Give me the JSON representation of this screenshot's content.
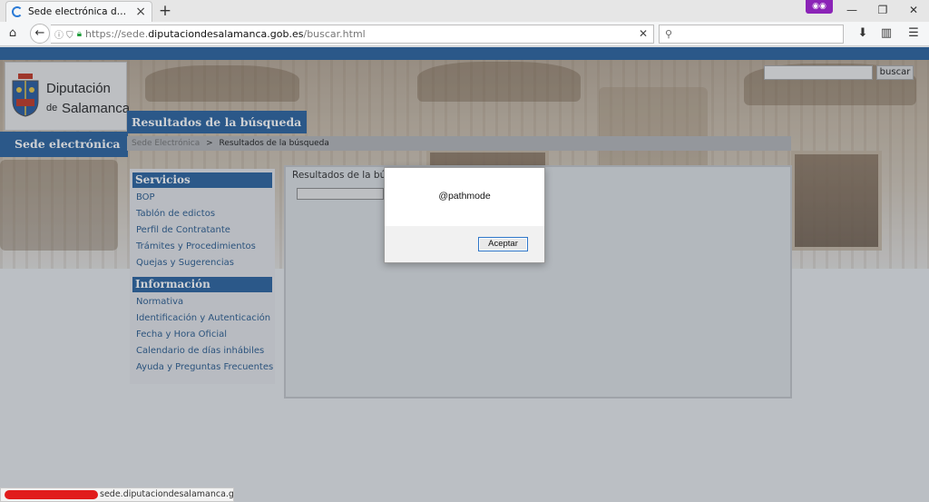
{
  "browser": {
    "tab_title": "Sede electrónica de la Dip...",
    "url_scheme": "https://sede.",
    "url_host": "diputaciondesalamanca.gob.es",
    "url_path": "/buscar.html",
    "icons": {
      "tab_loading": "loading-spinner-icon",
      "home": "home-icon",
      "back": "arrow-left-icon",
      "search": "magnifier-icon",
      "downloads": "download-arrow-icon",
      "sidebar": "sidebar-icon",
      "menu": "hamburger-menu-icon",
      "private": "private-browsing-mask-icon"
    }
  },
  "site": {
    "logo_line1": "Diputación",
    "logo_line2_prefix": "de",
    "logo_line2": "Salamanca",
    "sede_label": "Sede electrónica",
    "results_heading": "Resultados de la búsqueda",
    "search_button": "buscar",
    "breadcrumb": {
      "home": "Sede Electrónica",
      "separator": ">",
      "current": "Resultados de la búsqueda"
    },
    "accent_color": "#2f66a0"
  },
  "sidebar": {
    "servicios_title": "Servicios",
    "servicios": [
      "BOP",
      "Tablón de edictos",
      "Perfil de Contratante",
      "Trámites y Procedimientos",
      "Quejas y Sugerencias"
    ],
    "informacion_title": "Información",
    "informacion": [
      "Normativa",
      "Identificación y Autenticación",
      "Fecha y Hora Oficial",
      "Calendario de días inhábiles",
      "Ayuda y Preguntas Frecuentes"
    ]
  },
  "content": {
    "title": "Resultados de la bús"
  },
  "dialog": {
    "message": "@pathmode",
    "button": "Aceptar"
  },
  "status_bar": {
    "text": "sede.diputaciondesalamanca.gob.es..."
  }
}
